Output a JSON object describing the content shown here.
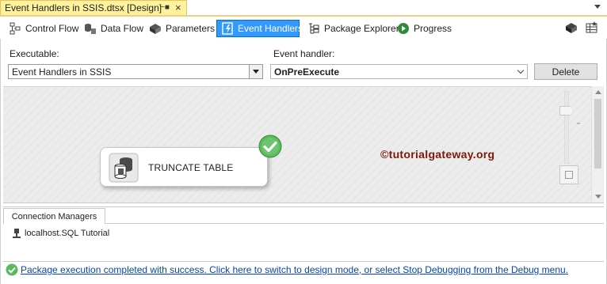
{
  "document_tab": {
    "title": "Event Handlers in SSIS.dtsx [Design]",
    "pin_icon": "pin-icon",
    "close_icon": "close-icon"
  },
  "toolbar": {
    "items": [
      {
        "label": "Control Flow",
        "icon": "control-flow-icon"
      },
      {
        "label": "Data Flow",
        "icon": "data-flow-icon"
      },
      {
        "label": "Parameters",
        "icon": "parameters-icon"
      },
      {
        "label": "Event Handlers",
        "icon": "event-handlers-icon",
        "active": true
      },
      {
        "label": "Package Explorer",
        "icon": "package-explorer-icon"
      },
      {
        "label": "Progress",
        "icon": "progress-icon"
      }
    ]
  },
  "selectors": {
    "executable_label": "Executable:",
    "executable_value": "Event Handlers in SSIS",
    "event_handler_label": "Event handler:",
    "event_handler_value": "OnPreExecute",
    "delete_label": "Delete"
  },
  "canvas": {
    "task_label": "TRUNCATE TABLE",
    "task_status": "success",
    "watermark": "©tutorialgateway.org"
  },
  "connection_managers": {
    "tab_label": "Connection Managers",
    "items": [
      {
        "label": "localhost.SQL Tutorial",
        "icon": "ole-db-connection-icon"
      }
    ]
  },
  "status": {
    "message": "Package execution completed with success. Click here to switch to design mode, or select Stop Debugging from the Debug menu."
  },
  "colors": {
    "active_tab": "#3399ff",
    "doc_tab": "#fff29d",
    "success": "#5cb85c",
    "watermark": "#7a1a0a",
    "link": "#0645ad"
  }
}
